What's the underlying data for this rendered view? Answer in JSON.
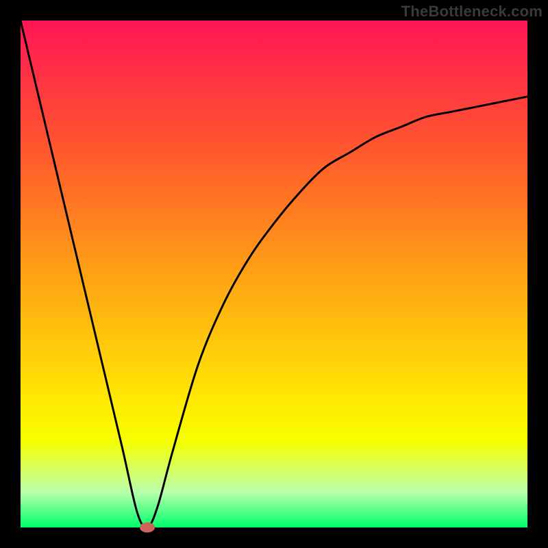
{
  "watermark": "TheBottleneck.com",
  "chart_data": {
    "type": "line",
    "title": "",
    "xlabel": "",
    "ylabel": "",
    "xlim": [
      0,
      100
    ],
    "ylim": [
      0,
      100
    ],
    "gradient_stops": [
      {
        "pos": 0,
        "color": "#ff1656"
      },
      {
        "pos": 25,
        "color": "#ff562e"
      },
      {
        "pos": 50,
        "color": "#ffa115"
      },
      {
        "pos": 75,
        "color": "#ffe903"
      },
      {
        "pos": 83,
        "color": "#f6ff00"
      },
      {
        "pos": 93,
        "color": "#baffac"
      },
      {
        "pos": 100,
        "color": "#00ff6a"
      }
    ],
    "series": [
      {
        "name": "bottleneck-curve",
        "x": [
          0,
          5,
          10,
          15,
          20,
          23,
          25,
          27,
          30,
          35,
          40,
          45,
          50,
          55,
          60,
          65,
          70,
          75,
          80,
          85,
          90,
          95,
          100
        ],
        "y": [
          100,
          79,
          58,
          37,
          16,
          3,
          0,
          4,
          15,
          32,
          44,
          53,
          60,
          66,
          71,
          74,
          77,
          79,
          81,
          82,
          83,
          84,
          85
        ]
      }
    ],
    "marker": {
      "x": 25,
      "y": 0,
      "color": "#cc6557"
    },
    "curve_stroke": "#000000",
    "curve_width": 3
  }
}
